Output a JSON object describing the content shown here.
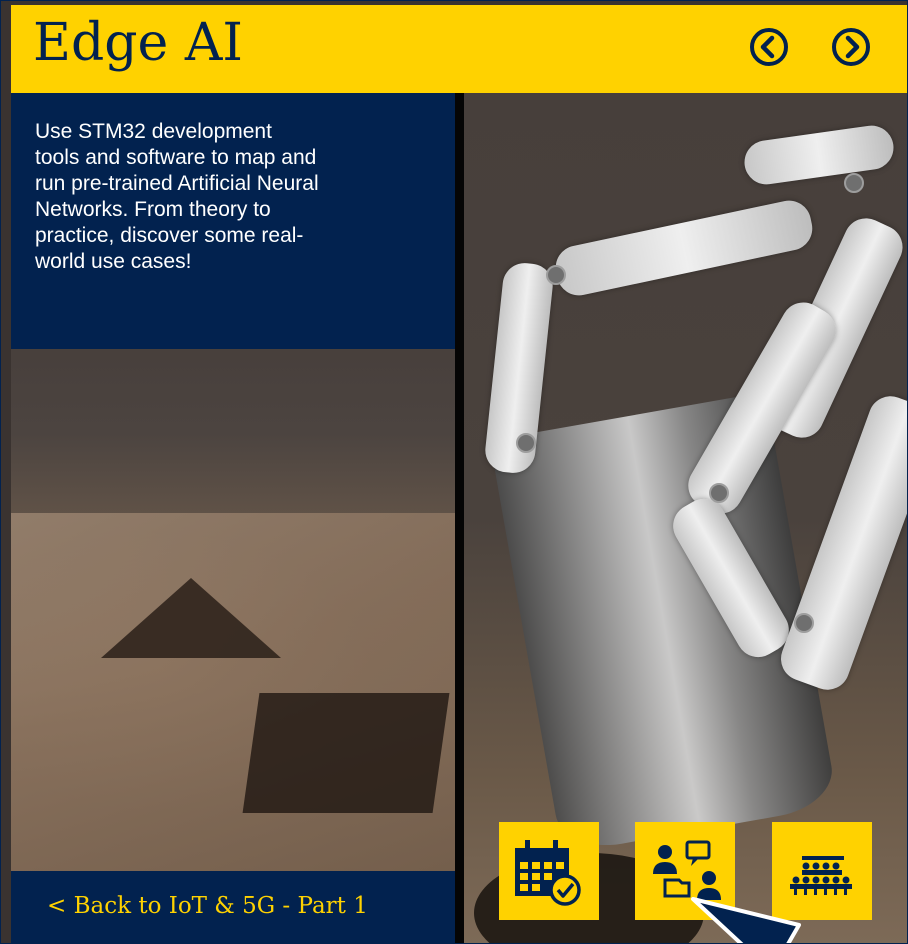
{
  "header": {
    "title": "Edge AI",
    "prev_icon": "chevron-left-circle-icon",
    "next_icon": "chevron-right-circle-icon"
  },
  "description": {
    "text": "Use STM32 development\ntools and  software to map and\nrun pre-trained Artificial Neural\nNetworks.  From theory to\npractice, discover some real-\nworld use cases!"
  },
  "back_link": {
    "label": "< Back to IoT & 5G - Part 1"
  },
  "icon_buttons": [
    {
      "icon": "calendar-check-icon"
    },
    {
      "icon": "people-chat-folder-icon"
    },
    {
      "icon": "audience-presentation-icon"
    }
  ],
  "colors": {
    "accent_yellow": "#ffd200",
    "navy": "#02224f"
  }
}
